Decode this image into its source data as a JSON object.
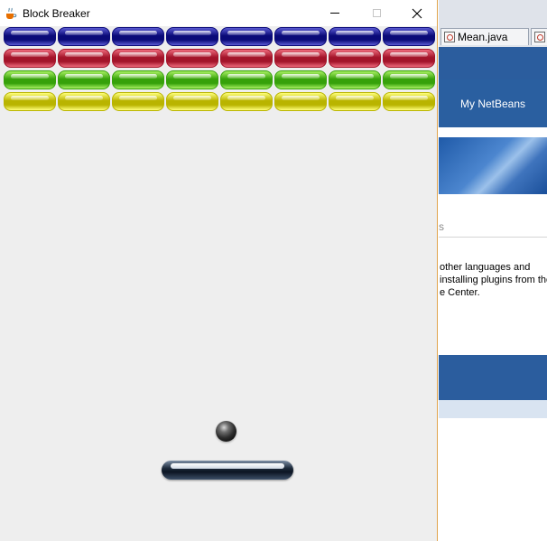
{
  "window": {
    "title": "Block Breaker",
    "controls": {
      "minimize": "minimize",
      "maximize": "maximize",
      "close": "close"
    }
  },
  "game": {
    "brick_rows": [
      {
        "color": "blue",
        "base": "#0a0a78",
        "light": "#5a5ad2",
        "count": 8
      },
      {
        "color": "red",
        "base": "#a3142a",
        "light": "#ee6a7c",
        "count": 8
      },
      {
        "color": "green",
        "base": "#36a10a",
        "light": "#a8f062",
        "count": 8
      },
      {
        "color": "yellow",
        "base": "#b9b400",
        "light": "#ffff7a",
        "count": 8
      }
    ],
    "background_color": "#eeeeee"
  },
  "background_ide": {
    "tab_label": "Mean.java",
    "nav_label": "My NetBeans",
    "link_fragment": "s",
    "text_lines": [
      "other languages and",
      "installing plugins from the",
      "e Center."
    ]
  }
}
